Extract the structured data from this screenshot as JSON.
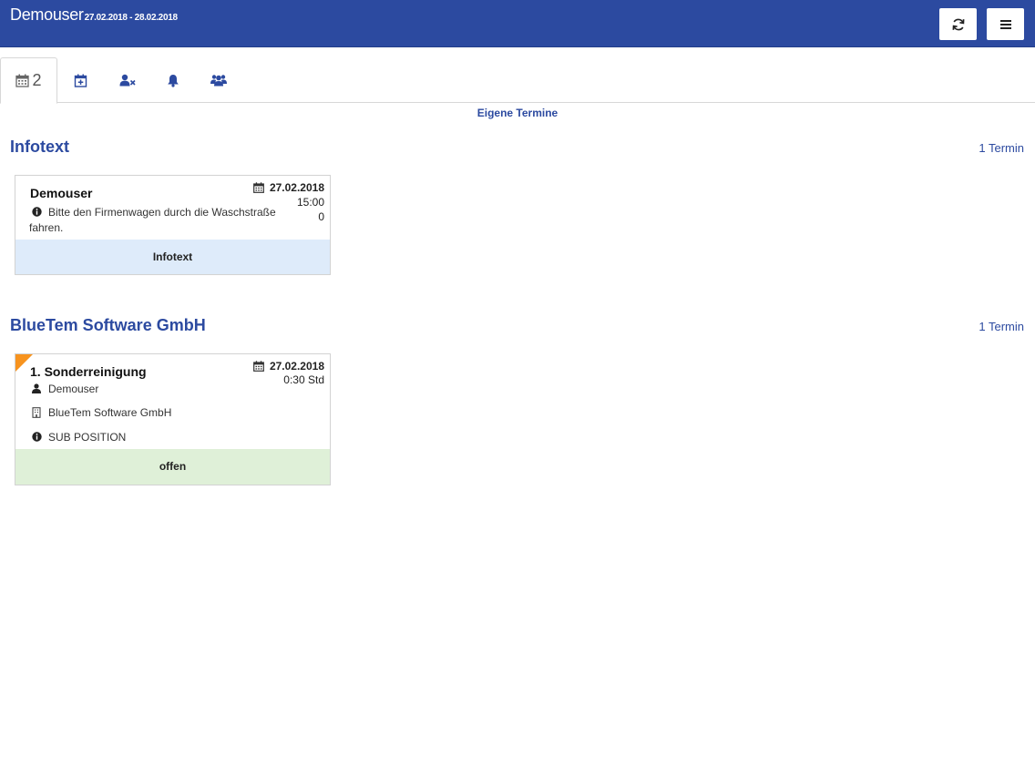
{
  "header": {
    "user": "Demouser",
    "date_range": "27.02.2018 - 28.02.2018"
  },
  "tabs": {
    "calendar_count": "2"
  },
  "section_label": "Eigene Termine",
  "groups": [
    {
      "title": "Infotext",
      "count": "1 Termin",
      "card": {
        "title": "Demouser",
        "date": "27.02.2018",
        "time": "15:00",
        "extra": "0",
        "info_line1": "Bitte den Firmenwagen durch die Waschstraße",
        "info_line2": "fahren.",
        "status": "Infotext"
      }
    },
    {
      "title": "BlueTem Software GmbH",
      "count": "1 Termin",
      "card": {
        "title": "1. Sonderreinigung",
        "date": "27.02.2018",
        "duration": "0:30 Std",
        "user": "Demouser",
        "company": "BlueTem Software GmbH",
        "position": "SUB POSITION",
        "status": "offen"
      }
    }
  ],
  "colors": {
    "brand": "#2c4aa0",
    "info_footer": "#deebfa",
    "open_footer": "#dff0d8",
    "corner_flag": "#f7931e"
  },
  "icons": [
    "refresh-icon",
    "menu-icon",
    "calendar-icon",
    "calendar-plus-icon",
    "user-x-icon",
    "bell-icon",
    "users-icon",
    "info-icon",
    "user-icon",
    "building-icon"
  ]
}
